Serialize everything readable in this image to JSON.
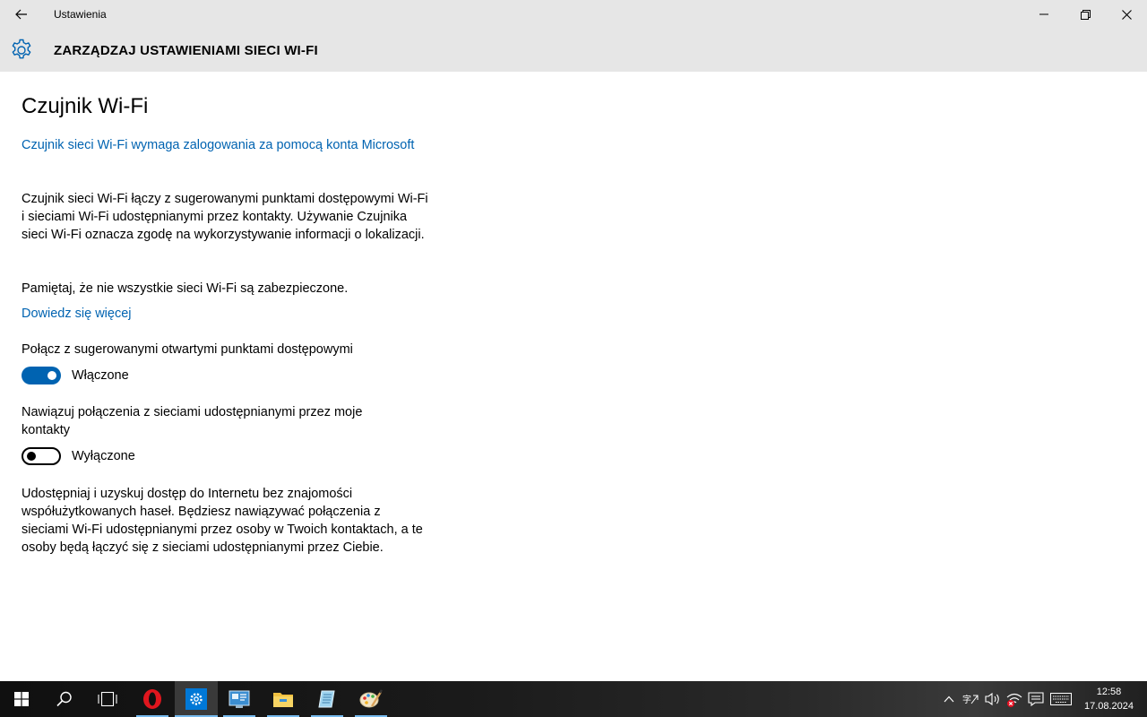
{
  "window": {
    "app_title": "Ustawienia",
    "page_heading": "ZARZĄDZAJ USTAWIENIAMI SIECI WI-FI"
  },
  "content": {
    "section_title": "Czujnik Wi-Fi",
    "ms_account_link": "Czujnik sieci Wi-Fi wymaga zalogowania za pomocą konta Microsoft",
    "description": "Czujnik sieci Wi-Fi łączy z sugerowanymi punktami dostępowymi Wi-Fi i sieciami Wi-Fi udostępnianymi przez kontakty. Używanie Czujnika sieci Wi-Fi oznacza zgodę na wykorzystywanie informacji o lokalizacji.",
    "security_note": "Pamiętaj, że nie wszystkie sieci Wi-Fi są zabezpieczone.",
    "learn_more_link": "Dowiedz się więcej",
    "setting_open_hotspots": {
      "label": "Połącz z sugerowanymi otwartymi punktami dostępowymi",
      "state": "Włączone",
      "on": true
    },
    "setting_contacts_networks": {
      "label": "Nawiązuj połączenia z sieciami udostępnianymi przez moje kontakty",
      "state": "Wyłączone",
      "on": false
    },
    "sharing_description": "Udostępniaj i uzyskuj dostęp do Internetu bez znajomości współużytkowanych haseł. Będziesz nawiązywać połączenia z sieciami Wi-Fi udostępnianymi przez osoby w Twoich kontaktach, a te osoby będą łączyć się z sieciami udostępnianymi przez Ciebie."
  },
  "taskbar": {
    "apps": [
      "start-icon",
      "search-icon",
      "task-view-icon",
      "opera-icon",
      "settings-icon",
      "control-panel-icon",
      "file-explorer-icon",
      "notepad-icon",
      "paint-icon"
    ],
    "clock_time": "12:58",
    "clock_date": "17.08.2024"
  },
  "colors": {
    "accent": "#0063b1",
    "chrome": "#e6e6e6"
  }
}
